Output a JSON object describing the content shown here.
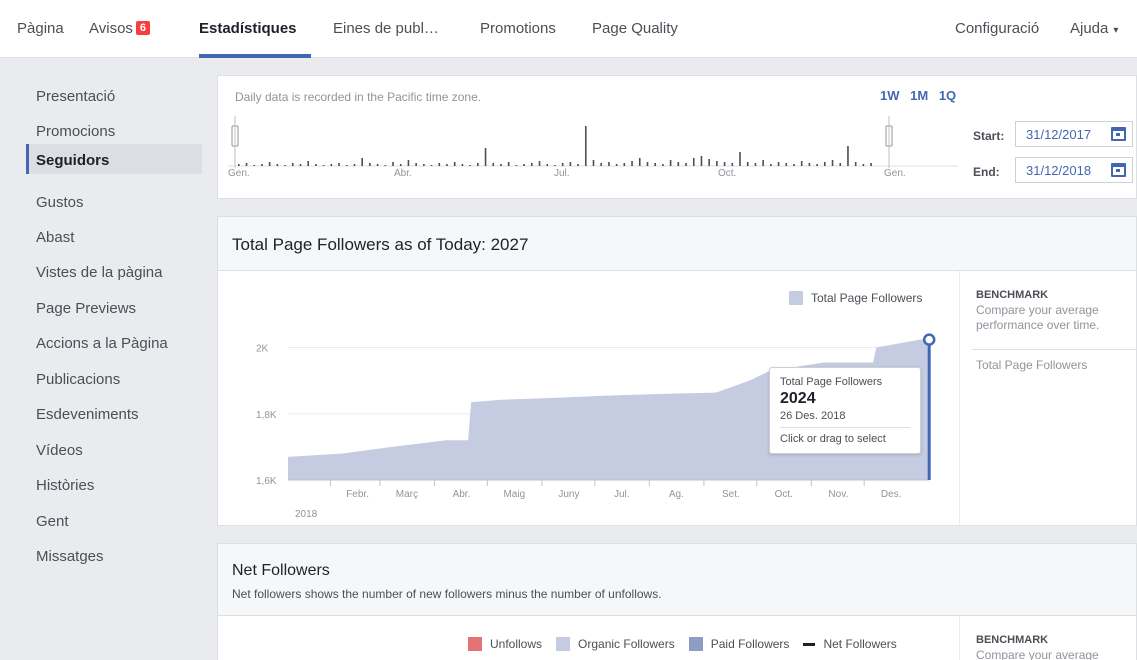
{
  "topnav": {
    "items": [
      "Pàgina",
      "Avisos",
      "Estadístiques",
      "Eines de publ…",
      "Promotions",
      "Page Quality"
    ],
    "notification_count": "6",
    "settings": "Configuració",
    "help": "Ajuda"
  },
  "sidebar": {
    "items": [
      "Presentació",
      "Promocions",
      "Seguidors",
      "Gustos",
      "Abast",
      "Vistes de la pàgina",
      "Page Previews",
      "Accions a la Pàgina",
      "Publicacions",
      "Esdeveniments",
      "Vídeos",
      "Històries",
      "Gent",
      "Missatges"
    ],
    "active_index": 2
  },
  "timeline": {
    "note": "Daily data is recorded in the Pacific time zone.",
    "ranges": [
      "1W",
      "1M",
      "1Q"
    ],
    "month_labels": [
      "Gen.",
      "Abr.",
      "Jul.",
      "Oct.",
      "Gen."
    ],
    "start_label": "Start:",
    "start_value": "31/12/2017",
    "end_label": "End:",
    "end_value": "31/12/2018"
  },
  "followers_section": {
    "title": "Total Page Followers as of Today: 2027",
    "legend": "Total Page Followers",
    "tooltip": {
      "label": "Total Page Followers",
      "value": "2024",
      "date": "26 Des. 2018",
      "hint": "Click or drag to select"
    }
  },
  "benchmark": {
    "title": "BENCHMARK",
    "subtitle": "Compare your average performance over time.",
    "item": "Total Page Followers",
    "title2": "BENCHMARK",
    "subtitle2": "Compare your average"
  },
  "net_section": {
    "title": "Net Followers",
    "subtitle": "Net followers shows the number of new followers minus the number of unfollows.",
    "legend": [
      "Unfollows",
      "Organic Followers",
      "Paid Followers",
      "Net Followers"
    ]
  },
  "colors": {
    "area": "#c5cbe0",
    "line": "#4267b2",
    "unfollows": "#e57373",
    "organic": "#c5cbe0",
    "paid": "#8b9dc3"
  },
  "chart_data": {
    "type": "area",
    "x": [
      "2018-01-01",
      "2018-02-01",
      "2018-03-01",
      "2018-04-01",
      "2018-04-15",
      "2018-05-01",
      "2018-06-01",
      "2018-07-01",
      "2018-08-01",
      "2018-09-01",
      "2018-09-20",
      "2018-10-01",
      "2018-11-01",
      "2018-12-01",
      "2018-12-26",
      "2018-12-31"
    ],
    "series": [
      {
        "name": "Total Page Followers",
        "values": [
          1670,
          1680,
          1700,
          1720,
          1835,
          1842,
          1848,
          1855,
          1860,
          1864,
          1900,
          1928,
          1955,
          2000,
          2024,
          2027
        ]
      }
    ],
    "x_tick_labels": [
      "Febr.",
      "Març",
      "Abr.",
      "Maig",
      "Juny",
      "Jul.",
      "Ag.",
      "Set.",
      "Oct.",
      "Nov.",
      "Des."
    ],
    "year_label": "2018",
    "y_tick_labels": [
      "1,6K",
      "1,8K",
      "2K"
    ],
    "ylim": [
      1600,
      2050
    ],
    "legend_position": "top-right"
  }
}
